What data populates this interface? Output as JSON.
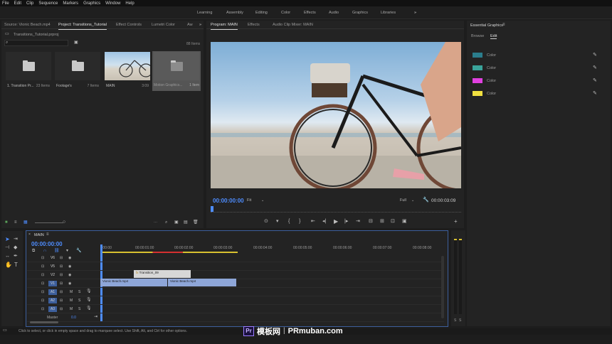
{
  "menu": [
    "File",
    "Edit",
    "Clip",
    "Sequence",
    "Markers",
    "Graphics",
    "Window",
    "Help"
  ],
  "workspaces": [
    "Learning",
    "Assembly",
    "Editing",
    "Color",
    "Effects",
    "Audio",
    "Graphics",
    "Libraries"
  ],
  "workspace_more": "»",
  "project_panel": {
    "tabs": [
      "Source: Vionic Beach.mp4",
      "Project: Transitions_Tutorial",
      "Effect Controls",
      "Lumetri Color",
      "Aw"
    ],
    "tab_more": "»",
    "file": "Transitions_Tutorial.prproj",
    "items_count": "88 Items",
    "bins": [
      {
        "label": "1. Transition Pr...",
        "count": "23 Items",
        "type": "folder"
      },
      {
        "label": "Footage's",
        "count": "7 Items",
        "type": "folder"
      },
      {
        "label": "MAIN",
        "count": "3:09",
        "type": "sequence"
      },
      {
        "label": "Motion Graphics...",
        "count": "1 Item",
        "type": "folder"
      }
    ]
  },
  "program_panel": {
    "tabs": [
      "Program: MAIN",
      "Effects",
      "Audio Clip Mixer: MAIN"
    ],
    "timecode": "00:00:00:00",
    "fit": "Fit",
    "resolution": "Full",
    "duration": "00:00:03:09"
  },
  "essential_graphics": {
    "title": "Essential Graphics",
    "tabs": [
      "Browse",
      "Edit"
    ],
    "colors": [
      {
        "label": "Color",
        "hex": "#2b7d8c"
      },
      {
        "label": "Color",
        "hex": "#3aa39a"
      },
      {
        "label": "Color",
        "hex": "#e040e0"
      },
      {
        "label": "Color",
        "hex": "#f0e040"
      }
    ]
  },
  "timeline": {
    "tab": "MAIN",
    "timecode": "00:00:00:00",
    "ruler": [
      ":00:00",
      "00:00:01:00",
      "00:00:02:00",
      "00:00:03:00",
      "00:00:04:00",
      "00:00:05:00",
      "00:00:06:00",
      "00:00:07:00",
      "00:00:08:00"
    ],
    "video_tracks": [
      "V6",
      "V5",
      "V2",
      "V1"
    ],
    "audio_tracks": [
      "A1",
      "A2",
      "A3"
    ],
    "master": "Master",
    "master_value": "0.0",
    "clips": {
      "transition": "Transition_09",
      "clip1": "Vionic Beach.mp4",
      "clip2": "Vionic Beach.mp4"
    }
  },
  "meter_labels": [
    "S",
    "S"
  ],
  "status": "Click to select, or click in empty space and drag to marquee select. Use Shift, Alt, and Ctrl for other options.",
  "watermark": {
    "badge": "Pr",
    "text": "模板网",
    "sep": "|",
    "site": "PRmuban.com"
  }
}
